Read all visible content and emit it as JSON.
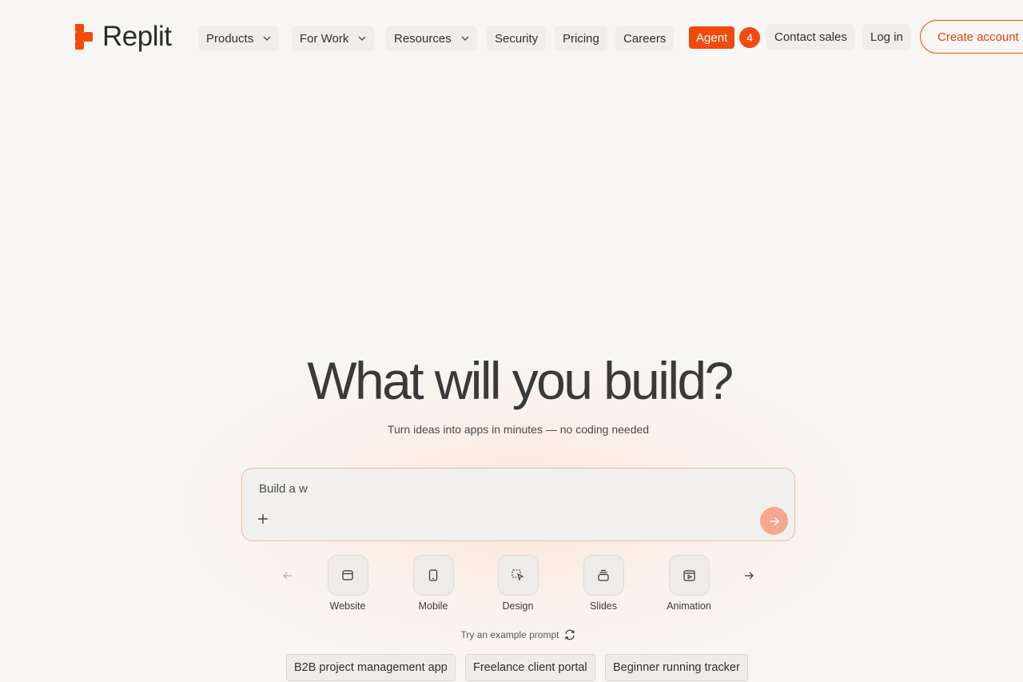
{
  "brand": {
    "name": "Replit",
    "accent": "#f24a0c"
  },
  "nav": {
    "products": "Products",
    "for_work": "For Work",
    "resources": "Resources",
    "security": "Security",
    "pricing": "Pricing",
    "careers": "Careers",
    "agent": "Agent",
    "agent_count": "4",
    "contact_sales": "Contact sales",
    "log_in": "Log in",
    "create_account": "Create account"
  },
  "hero": {
    "headline": "What will you build?",
    "subline": "Turn ideas into apps in minutes — no coding needed"
  },
  "prompt": {
    "value": "Build a w"
  },
  "categories": [
    {
      "label": "Website",
      "icon": "browser-window-icon"
    },
    {
      "label": "Mobile",
      "icon": "phone-icon"
    },
    {
      "label": "Design",
      "icon": "select-cursor-icon"
    },
    {
      "label": "Slides",
      "icon": "slides-stack-icon"
    },
    {
      "label": "Animation",
      "icon": "play-window-icon"
    }
  ],
  "examples": {
    "label": "Try an example prompt",
    "chips": [
      "B2B project management app",
      "Freelance client portal",
      "Beginner running tracker"
    ]
  }
}
